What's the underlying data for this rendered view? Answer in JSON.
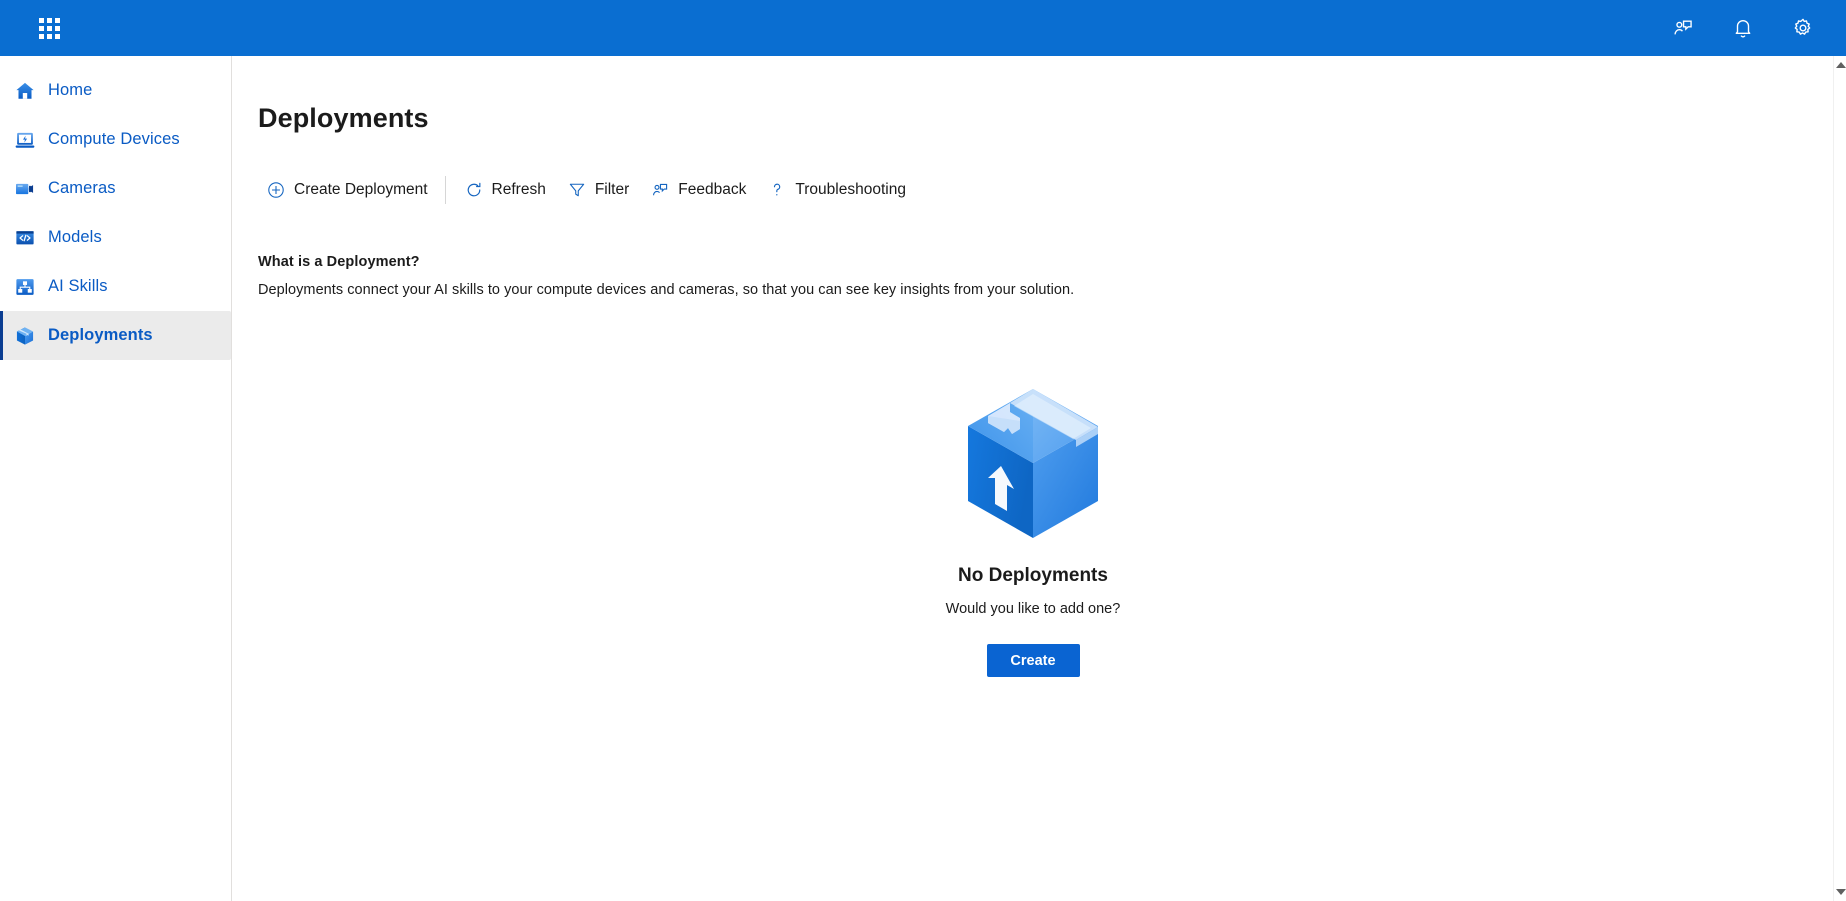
{
  "topbar": {
    "background": "#0a6ed1",
    "waffle_icon": "app-grid-icon",
    "actions": [
      {
        "icon": "feedback-person-icon",
        "label": "Feedback"
      },
      {
        "icon": "notification-bell-icon",
        "label": "Notifications"
      },
      {
        "icon": "settings-gear-icon",
        "label": "Settings"
      }
    ]
  },
  "sidebar": {
    "accent": "#0b3d91",
    "selected_background": "#ebebeb",
    "link_color": "#0a5bc4",
    "items": [
      {
        "label": "Home",
        "icon": "home-icon",
        "selected": false
      },
      {
        "label": "Compute Devices",
        "icon": "compute-device-icon",
        "selected": false
      },
      {
        "label": "Cameras",
        "icon": "camera-icon",
        "selected": false
      },
      {
        "label": "Models",
        "icon": "code-window-icon",
        "selected": false
      },
      {
        "label": "AI Skills",
        "icon": "hierarchy-icon",
        "selected": false
      },
      {
        "label": "Deployments",
        "icon": "package-box-icon",
        "selected": true
      }
    ]
  },
  "main": {
    "title": "Deployments",
    "toolbar": [
      {
        "label": "Create Deployment",
        "icon": "add-circle-icon"
      },
      {
        "label": "Refresh",
        "icon": "refresh-icon"
      },
      {
        "label": "Filter",
        "icon": "filter-funnel-icon"
      },
      {
        "label": "Feedback",
        "icon": "feedback-person-icon"
      },
      {
        "label": "Troubleshooting",
        "icon": "question-mark-icon"
      }
    ],
    "about": {
      "heading": "What is a Deployment?",
      "body": "Deployments connect your AI skills to your compute devices and cameras, so that you can see key insights from your solution."
    },
    "empty_state": {
      "illustration": "package-box-illustration",
      "title": "No Deployments",
      "subtitle": "Would you like to add one?",
      "button_label": "Create",
      "button_color": "#0a64d2"
    }
  },
  "scrollbar": {
    "up_arrow": "scroll-up-arrow-icon",
    "down_arrow": "scroll-down-arrow-icon"
  }
}
